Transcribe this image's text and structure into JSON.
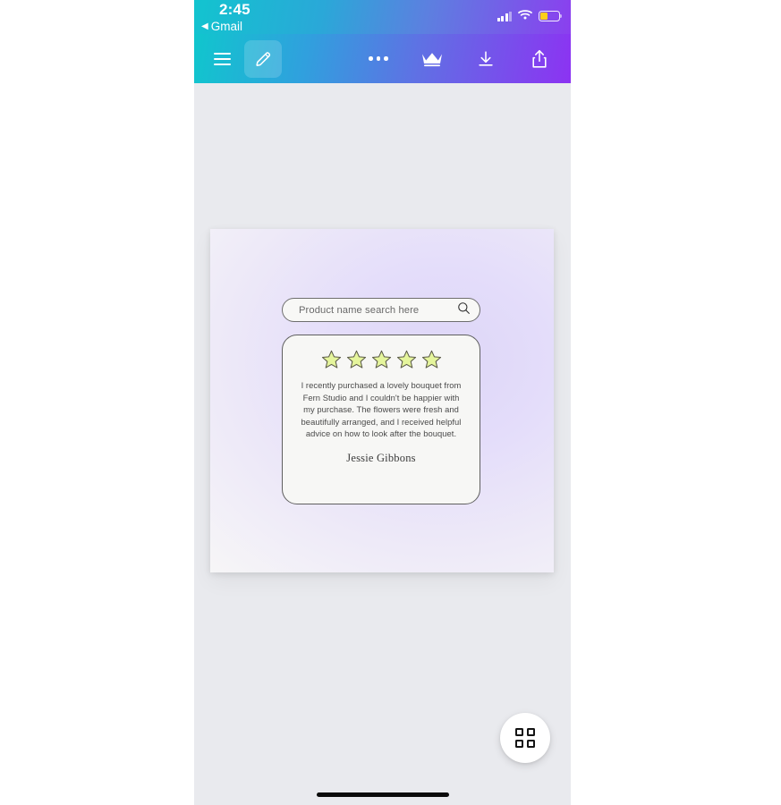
{
  "status_bar": {
    "time": "2:45",
    "back_arrow": "◀",
    "back_label": "Gmail",
    "signal_icon": "cellular-signal-icon",
    "wifi_icon": "wifi-icon",
    "battery_icon": "battery-low-icon",
    "battery_color": "#fccf1a"
  },
  "toolbar": {
    "menu_icon": "hamburger-menu-icon",
    "edit_icon": "pencil-edit-icon",
    "more_icon": "more-options-icon",
    "premium_icon": "crown-icon",
    "download_icon": "download-icon",
    "share_icon": "share-icon",
    "gradient_start": "#10c6cd",
    "gradient_end": "#8c33f2"
  },
  "canvas": {
    "background_from": "#ddd6f7",
    "background_to": "#fafafa",
    "search": {
      "placeholder": "Product name search here",
      "value": "",
      "icon": "search-icon"
    },
    "review": {
      "rating": 5,
      "star_icon": "star-icon",
      "star_fill": "#e5f59c",
      "star_stroke": "#5a5a47",
      "text": "I recently purchased a lovely bouquet from Fern Studio and I couldn't be happier with my purchase. The flowers were fresh and beautifully arranged, and I received helpful advice on how to look after the bouquet.",
      "author": "Jessie Gibbons"
    }
  },
  "fab": {
    "icon": "grid-layout-icon",
    "label": ""
  },
  "home_indicator": {
    "label": ""
  }
}
